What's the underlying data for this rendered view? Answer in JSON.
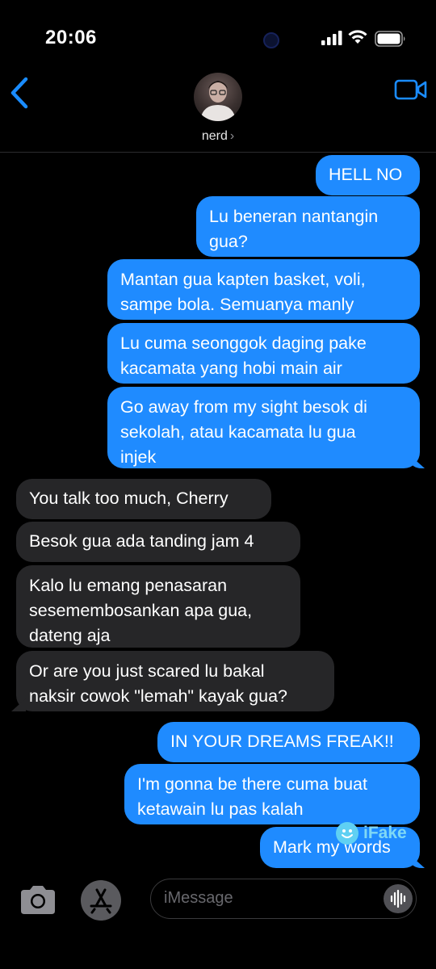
{
  "status_bar": {
    "time": "20:06"
  },
  "header": {
    "contact_name": "nerd",
    "chevron": "›"
  },
  "messages": [
    {
      "side": "out",
      "text": "HELL NO"
    },
    {
      "side": "out",
      "text": "Lu beneran nantangin\ngua?"
    },
    {
      "side": "out",
      "text": "Mantan gua kapten basket, voli,\nsampe bola. Semuanya manly"
    },
    {
      "side": "out",
      "text": "Lu cuma seonggok daging pake\nkacamata yang hobi main air"
    },
    {
      "side": "out",
      "text": "Go away from my sight besok di\nsekolah, atau kacamata lu gua\ninjek"
    },
    {
      "side": "in",
      "text": "You talk too much, Cherry"
    },
    {
      "side": "in",
      "text": "Besok gua ada tanding jam 4"
    },
    {
      "side": "in",
      "text": "Kalo lu emang penasaran\nsesemembosankan apa gua,\ndateng aja"
    },
    {
      "side": "in",
      "text": "Or are you just scared lu bakal\nnaksir cowok \"lemah\" kayak gua?"
    },
    {
      "side": "out",
      "text": "IN YOUR DREAMS FREAK!!"
    },
    {
      "side": "out",
      "text": "I'm gonna be there cuma buat\nketawain lu pas kalah"
    },
    {
      "side": "out",
      "text": "Mark my words"
    }
  ],
  "watermark": {
    "text": "iFake"
  },
  "input": {
    "placeholder": "iMessage"
  },
  "colors": {
    "outgoing": "#1f8bff",
    "incoming": "#262628",
    "accent": "#1a8cff"
  },
  "icons": [
    "back-chevron-icon",
    "video-call-icon",
    "camera-icon",
    "app-store-icon",
    "audio-waveform-icon"
  ]
}
